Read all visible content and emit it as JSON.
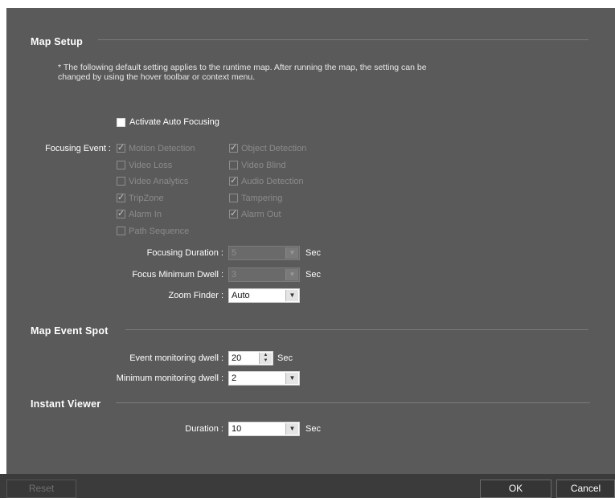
{
  "map_setup": {
    "title": "Map Setup",
    "note_line1": "* The following default setting applies to the runtime map. After running the map, the setting can be",
    "note_line2": "changed by using the hover toolbar or context menu.",
    "activate_auto_focusing": {
      "label": "Activate Auto Focusing",
      "checked": false
    },
    "focusing_event_label": "Focusing Event :",
    "events": [
      {
        "label": "Motion Detection",
        "checked": true
      },
      {
        "label": "Object Detection",
        "checked": true
      },
      {
        "label": "Video Loss",
        "checked": false
      },
      {
        "label": "Video Blind",
        "checked": false
      },
      {
        "label": "Video Analytics",
        "checked": false
      },
      {
        "label": "Audio Detection",
        "checked": true
      },
      {
        "label": "TripZone",
        "checked": true
      },
      {
        "label": "Tampering",
        "checked": false
      },
      {
        "label": "Alarm In",
        "checked": true
      },
      {
        "label": "Alarm Out",
        "checked": true
      },
      {
        "label": "Path Sequence",
        "checked": false
      }
    ],
    "focusing_duration": {
      "label": "Focusing Duration :",
      "value": "5",
      "unit": "Sec"
    },
    "focus_minimum_dwell": {
      "label": "Focus Minimum Dwell :",
      "value": "3",
      "unit": "Sec"
    },
    "zoom_finder": {
      "label": "Zoom Finder :",
      "value": "Auto"
    }
  },
  "map_event_spot": {
    "title": "Map Event Spot",
    "event_monitoring_dwell": {
      "label": "Event monitoring dwell :",
      "value": "20",
      "unit": "Sec"
    },
    "minimum_monitoring_dwell": {
      "label": "Minimum monitoring dwell :",
      "value": "2"
    }
  },
  "instant_viewer": {
    "title": "Instant Viewer",
    "duration": {
      "label": "Duration :",
      "value": "10",
      "unit": "Sec"
    }
  },
  "buttons": {
    "reset": "Reset",
    "ok": "OK",
    "cancel": "Cancel"
  }
}
